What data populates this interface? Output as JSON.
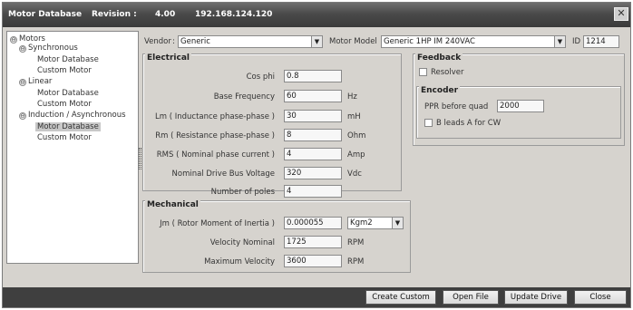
{
  "titlebar": {
    "app_title": "Motor Database",
    "revision_label": "Revision :",
    "revision_value": "4.00",
    "ip_address": "192.168.124.120"
  },
  "tree": {
    "root": "Motors",
    "synchronous": "Synchronous",
    "sync_motor_database": "Motor Database",
    "sync_custom_motor": "Custom Motor",
    "linear": "Linear",
    "linear_motor_database": "Motor Database",
    "linear_custom_motor": "Custom Motor",
    "induction": "Induction / Asynchronous",
    "induction_motor_database": "Motor Database",
    "induction_custom_motor": "Custom Motor"
  },
  "selectors": {
    "vendor_label": "Vendor",
    "vendor_value": "Generic",
    "model_label": "Motor Model",
    "model_value": "Generic 1HP IM 240VAC",
    "id_label": "ID",
    "id_value": "1214"
  },
  "electrical": {
    "title": "Electrical",
    "rows": [
      {
        "label": "Cos phi",
        "value": "0.8",
        "unit": ""
      },
      {
        "label": "Base Frequency",
        "value": "60",
        "unit": "Hz"
      },
      {
        "label": "Lm ( Inductance phase-phase )",
        "value": "30",
        "unit": "mH"
      },
      {
        "label": "Rm ( Resistance phase-phase )",
        "value": "8",
        "unit": "Ohm"
      },
      {
        "label": "RMS ( Nominal phase current )",
        "value": "4",
        "unit": "Amp"
      },
      {
        "label": "Nominal Drive Bus Voltage",
        "value": "320",
        "unit": "Vdc"
      },
      {
        "label": "Number of poles",
        "value": "4",
        "unit": ""
      }
    ]
  },
  "mechanical": {
    "title": "Mechanical",
    "jm_label": "Jm ( Rotor Moment of Inertia )",
    "jm_value": "0.000055",
    "jm_unit": "Kgm2",
    "velocity_nominal_label": "Velocity Nominal",
    "velocity_nominal_value": "1725",
    "velocity_nominal_unit": "RPM",
    "max_velocity_label": "Maximum Velocity",
    "max_velocity_value": "3600",
    "max_velocity_unit": "RPM"
  },
  "feedback": {
    "title": "Feedback",
    "resolver_label": "Resolver",
    "resolver_checked": false
  },
  "encoder": {
    "title": "Encoder",
    "ppr_label": "PPR before quad",
    "ppr_value": "2000",
    "b_leads_label": "B leads A for CW",
    "b_leads_checked": false
  },
  "buttons": {
    "create_custom": "Create Custom",
    "open_file": "Open File",
    "update_drive": "Update Drive",
    "close": "Close"
  },
  "icons": {
    "close": "close-icon",
    "dropdown": "chevron-down-icon",
    "tree_toggle": "tree-expand-icon"
  }
}
